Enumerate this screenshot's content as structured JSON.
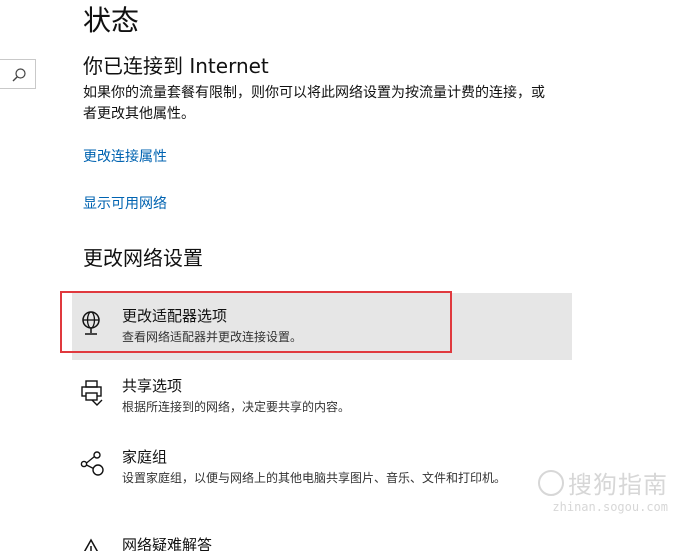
{
  "header": {
    "title": "状态"
  },
  "search": {
    "icon": "search-icon"
  },
  "connection": {
    "title": "你已连接到 Internet",
    "description": "如果你的流量套餐有限制，则你可以将此网络设置为按流量计费的连接，或者更改其他属性。"
  },
  "links": {
    "change_properties": "更改连接属性",
    "show_networks": "显示可用网络"
  },
  "change_settings": {
    "title": "更改网络设置",
    "items": [
      {
        "title": "更改适配器选项",
        "description": "查看网络适配器并更改连接设置。",
        "icon": "adapter-globe-icon"
      },
      {
        "title": "共享选项",
        "description": "根据所连接到的网络，决定要共享的内容。",
        "icon": "sharing-printer-icon"
      },
      {
        "title": "家庭组",
        "description": "设置家庭组，以便与网络上的其他电脑共享图片、音乐、文件和打印机。",
        "icon": "homegroup-icon"
      },
      {
        "title": "网络疑难解答",
        "icon": "warning-icon"
      }
    ]
  },
  "watermark": {
    "main": "搜狗指南",
    "sub": "zhinan.sogou.com"
  },
  "colors": {
    "link": "#0063b1",
    "highlight_bg": "#e6e6e6",
    "annotation": "#e0393e"
  }
}
